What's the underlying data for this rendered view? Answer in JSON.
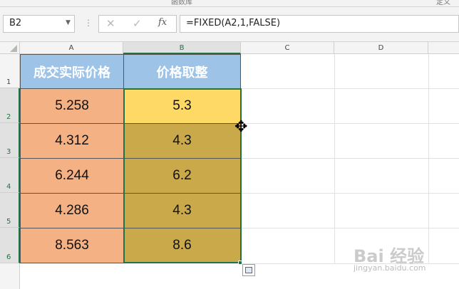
{
  "ribbon": {
    "group_label": "函数库",
    "right_label": "定义"
  },
  "formula_bar": {
    "name_box": "B2",
    "cancel_glyph": "✕",
    "enter_glyph": "✓",
    "fx_label": "fx",
    "formula": "=FIXED(A2,1,FALSE)"
  },
  "columns": [
    "A",
    "B",
    "C",
    "D"
  ],
  "rows": [
    "1",
    "2",
    "3",
    "4",
    "5",
    "6"
  ],
  "table": {
    "headers": [
      "成交实际价格",
      "价格取整"
    ],
    "rows": [
      [
        "5.258",
        "5.3"
      ],
      [
        "4.312",
        "4.3"
      ],
      [
        "6.244",
        "6.2"
      ],
      [
        "4.286",
        "4.3"
      ],
      [
        "8.563",
        "8.6"
      ]
    ]
  },
  "colors": {
    "header_fill": "#9dc3e6",
    "col_a_fill": "#f4b183",
    "col_b_fill": "#c9a94a",
    "active_fill": "#ffd966",
    "selection": "#217346"
  },
  "watermark": {
    "main": "Bai 经验",
    "sub": "jingyan.baidu.com"
  }
}
